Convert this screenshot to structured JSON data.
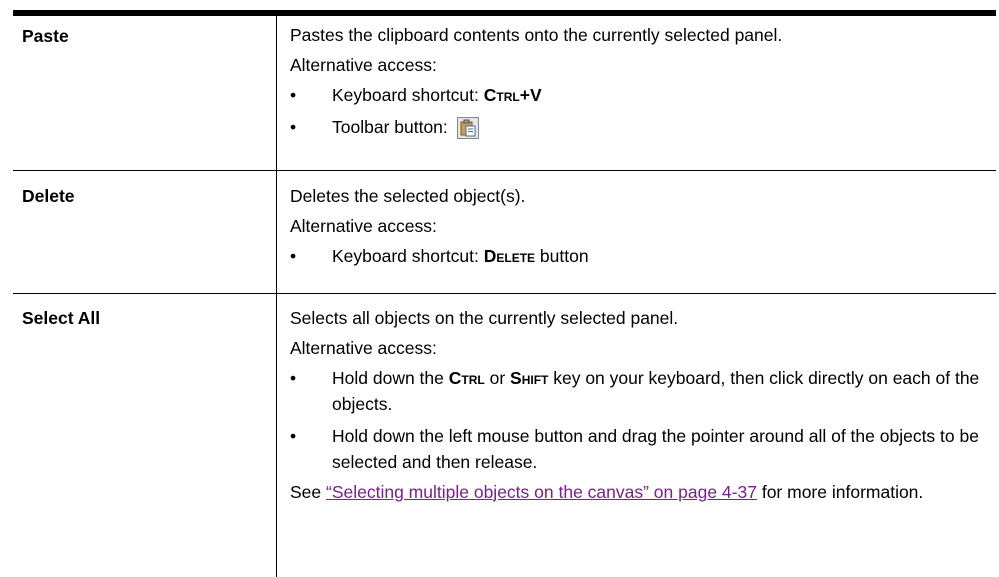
{
  "rows": [
    {
      "command": "Paste",
      "description": "Pastes the clipboard contents onto the currently selected panel.",
      "alt_label": "Alternative access:",
      "bullets": {
        "kb_prefix": "Keyboard shortcut: ",
        "kb_key": "Ctrl",
        "kb_plus": "+V",
        "tb_prefix": "Toolbar button: ",
        "tb_icon": "paste-icon"
      }
    },
    {
      "command": "Delete",
      "description": "Deletes the selected object(s).",
      "alt_label": "Alternative access:",
      "bullets": {
        "kb_prefix": "Keyboard shortcut: ",
        "kb_key": "Delete",
        "kb_suffix": " button"
      }
    },
    {
      "command": "Select All",
      "description": "Selects all objects on the currently selected panel.",
      "alt_label": "Alternative access:",
      "bullets": {
        "b1_prefix": "Hold down the ",
        "b1_key1": "Ctrl",
        "b1_or": " or ",
        "b1_key2": "Shift",
        "b1_suffix": " key on your keyboard, then click directly on each of the objects.",
        "b2": "Hold down the left mouse button and drag the pointer around all of the objects to be selected and then release."
      },
      "see_prefix": "See ",
      "see_link": "“Selecting multiple objects on the canvas” on page 4-37",
      "see_suffix": " for more information."
    }
  ],
  "bullet_char": "•",
  "colors": {
    "link": "#7a1f8f",
    "rule": "#000000"
  }
}
